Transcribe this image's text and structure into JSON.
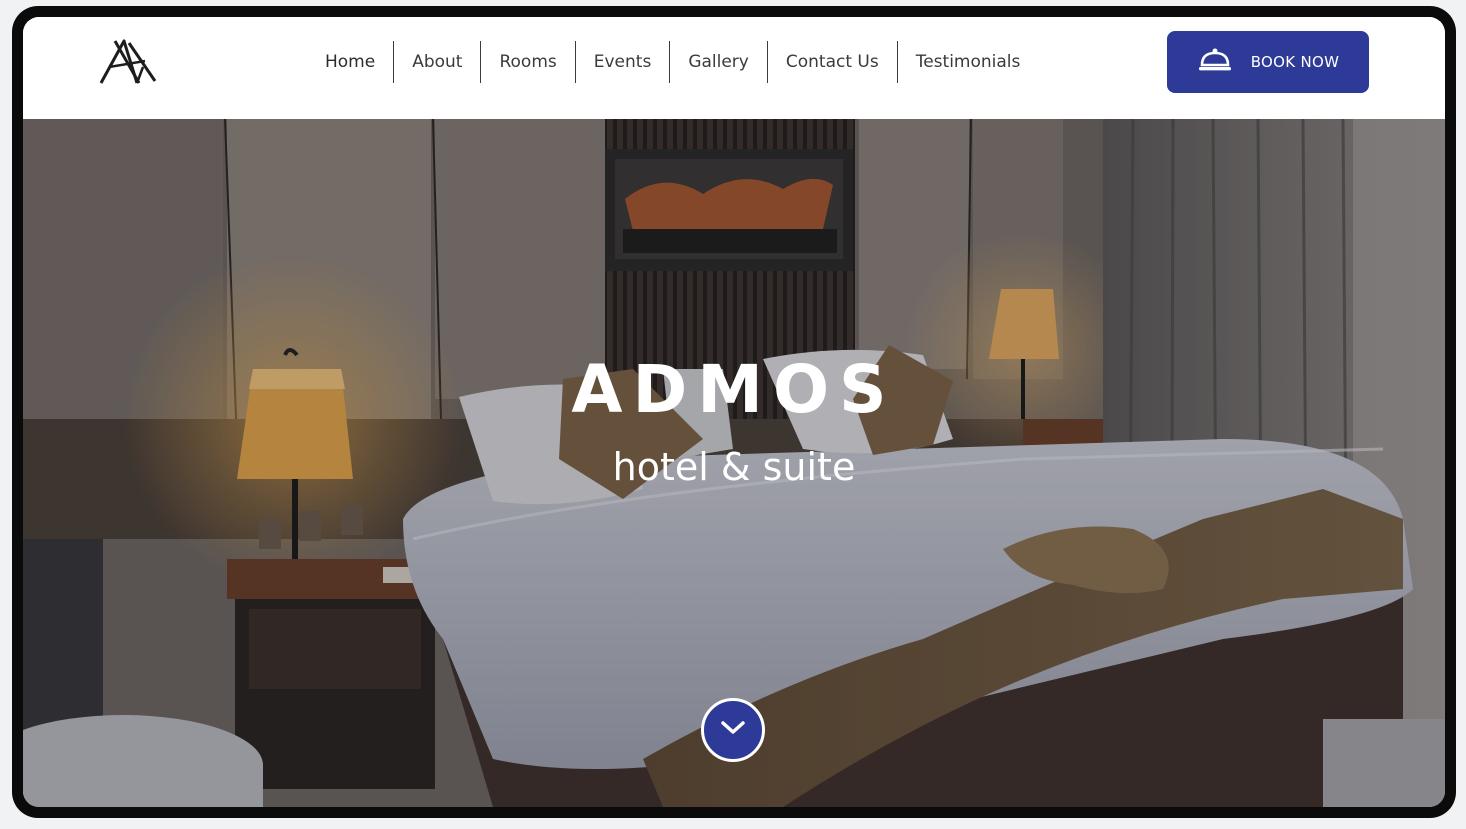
{
  "brand": {
    "logo_icon": "admos-monogram-logo"
  },
  "nav": {
    "items": [
      {
        "label": "Home"
      },
      {
        "label": "About"
      },
      {
        "label": "Rooms"
      },
      {
        "label": "Events"
      },
      {
        "label": "Gallery"
      },
      {
        "label": "Contact Us"
      },
      {
        "label": "Testimonials"
      }
    ],
    "active": "Home"
  },
  "book": {
    "label": "BOOK NOW",
    "icon": "cloche-icon"
  },
  "hero": {
    "title": "ADMOS",
    "subtitle": "hotel & suite",
    "scroll_icon": "chevron-down-icon"
  },
  "colors": {
    "accent": "#2d3a97",
    "nav_text": "#3b3b3b",
    "header_bg": "#ffffff",
    "frame": "#0b0b0b"
  }
}
